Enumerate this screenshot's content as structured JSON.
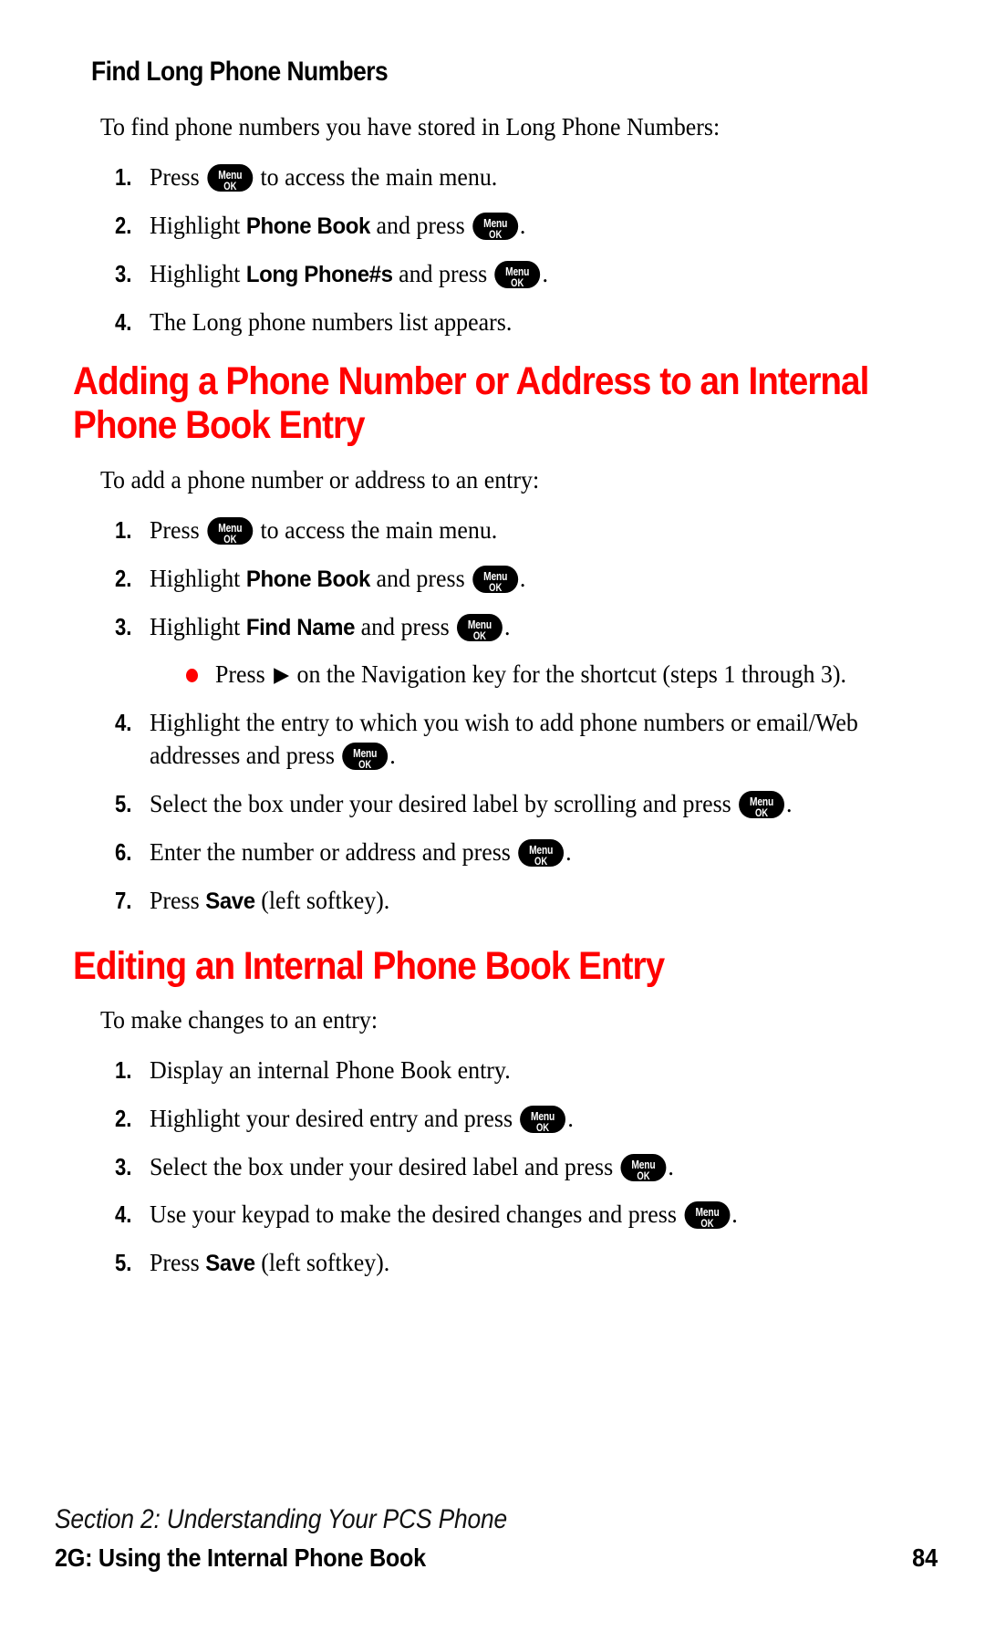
{
  "page": {
    "accent_color": "#ff0000",
    "text_color": "#000000",
    "background_color": "#ffffff"
  },
  "section_find_long": {
    "heading": "Find Long Phone Numbers",
    "lead": "To find phone numbers you have stored in Long Phone Numbers:",
    "steps": [
      {
        "num": "1.",
        "pre": "Press ",
        "key": true,
        "post": " to access the main menu."
      },
      {
        "num": "2.",
        "pre": "Highlight ",
        "bold": "Phone Book",
        "mid": " and press ",
        "key": true,
        "post": "."
      },
      {
        "num": "3.",
        "pre": "Highlight ",
        "bold": "Long Phone#s",
        "mid": " and press ",
        "key": true,
        "post": "."
      },
      {
        "num": "4.",
        "pre": "The Long phone numbers list appears.",
        "key": false,
        "post": ""
      }
    ]
  },
  "section_adding": {
    "heading": "Adding a Phone Number or Address to an Internal Phone Book Entry",
    "lead": "To add a phone number or address to an entry:",
    "steps": [
      {
        "num": "1.",
        "pre": "Press ",
        "key": true,
        "post": " to access the main menu."
      },
      {
        "num": "2.",
        "pre": "Highlight ",
        "bold": "Phone Book",
        "mid": " and press ",
        "key": true,
        "post": "."
      },
      {
        "num": "3.",
        "pre": "Highlight ",
        "bold": "Find Name",
        "mid": " and press ",
        "key": true,
        "post": "."
      },
      {
        "num": "4.",
        "pre": "Highlight the entry to which you wish to add phone numbers or email/Web addresses and press ",
        "key": true,
        "post": "."
      },
      {
        "num": "5.",
        "pre": "Select the box under your desired label by scrolling and press ",
        "key": true,
        "post": "."
      },
      {
        "num": "6.",
        "pre": "Enter the number or address and press ",
        "key": true,
        "post": "."
      },
      {
        "num": "7.",
        "pre": "Press ",
        "bold": "Save",
        "mid": " (left softkey).",
        "key": false,
        "post": ""
      }
    ],
    "bullet": {
      "pre": "Press ",
      "arrow": "▶",
      "post": " on the Navigation key for the shortcut (steps 1 through 3)."
    }
  },
  "section_editing": {
    "heading": "Editing an Internal Phone Book Entry",
    "lead": "To make changes to an entry:",
    "steps": [
      {
        "num": "1.",
        "pre": "Display an internal Phone Book entry.",
        "key": false,
        "post": ""
      },
      {
        "num": "2.",
        "pre": "Highlight your desired entry and press ",
        "key": true,
        "post": "."
      },
      {
        "num": "3.",
        "pre": "Select the box under your desired label and press ",
        "key": true,
        "post": "."
      },
      {
        "num": "4.",
        "pre": "Use your keypad to make the desired changes and press ",
        "key": true,
        "post": "."
      },
      {
        "num": "5.",
        "pre": "Press ",
        "bold": "Save",
        "mid": " (left softkey).",
        "key": false,
        "post": ""
      }
    ]
  },
  "menu_key": {
    "line1": "Menu",
    "line2": "OK"
  },
  "footer": {
    "section_line": "Section 2: Understanding Your PCS Phone",
    "chapter_line": "2G: Using the Internal Phone Book",
    "page_number": "84"
  }
}
